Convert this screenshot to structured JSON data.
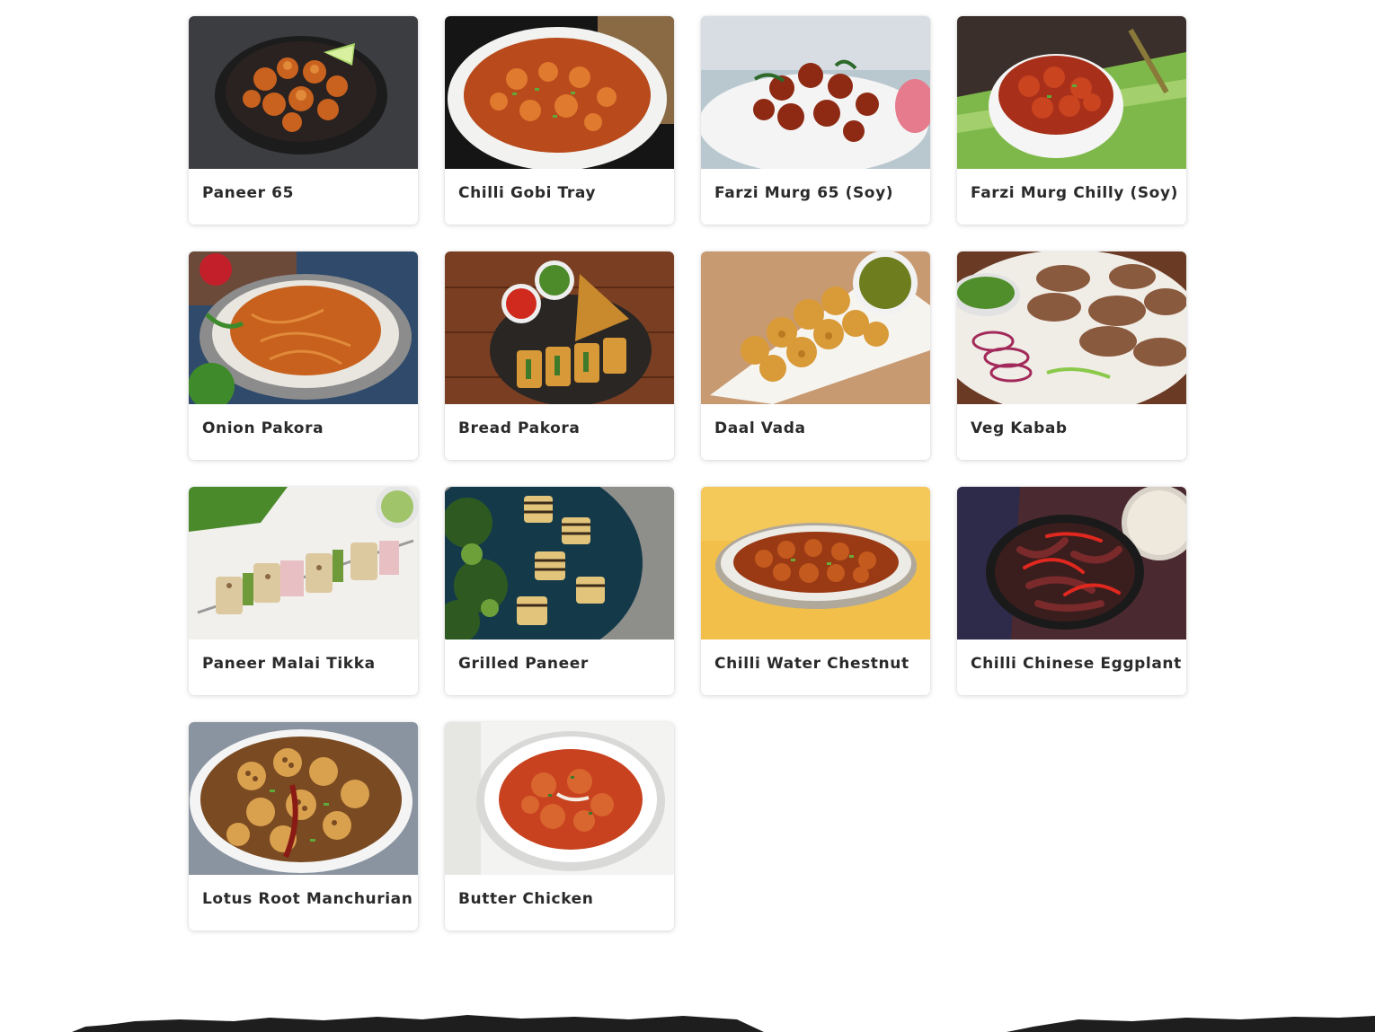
{
  "menu": {
    "items": [
      {
        "name": "Paneer 65",
        "image": "paneer-65-photo"
      },
      {
        "name": "Chilli Gobi Tray",
        "image": "chilli-gobi-tray-photo"
      },
      {
        "name": "Farzi Murg 65 (Soy)",
        "image": "farzi-murg-65-photo"
      },
      {
        "name": "Farzi Murg Chilly (Soy)",
        "image": "farzi-murg-chilly-photo"
      },
      {
        "name": "Onion Pakora",
        "image": "onion-pakora-photo"
      },
      {
        "name": "Bread Pakora",
        "image": "bread-pakora-photo"
      },
      {
        "name": "Daal Vada",
        "image": "daal-vada-photo"
      },
      {
        "name": "Veg Kabab",
        "image": "veg-kabab-photo"
      },
      {
        "name": "Paneer Malai Tikka",
        "image": "paneer-malai-tikka-photo"
      },
      {
        "name": "Grilled Paneer",
        "image": "grilled-paneer-photo"
      },
      {
        "name": "Chilli Water Chestnut",
        "image": "chilli-water-chestnut-photo"
      },
      {
        "name": "Chilli Chinese Eggplant",
        "image": "chilli-chinese-eggplant-photo"
      },
      {
        "name": "Lotus Root Manchurian",
        "image": "lotus-root-manchurian-photo"
      },
      {
        "name": "Butter Chicken",
        "image": "butter-chicken-photo"
      }
    ]
  },
  "colors": {
    "card_title": "#2a2a2a",
    "footer_edge": "#1e1e1e"
  }
}
